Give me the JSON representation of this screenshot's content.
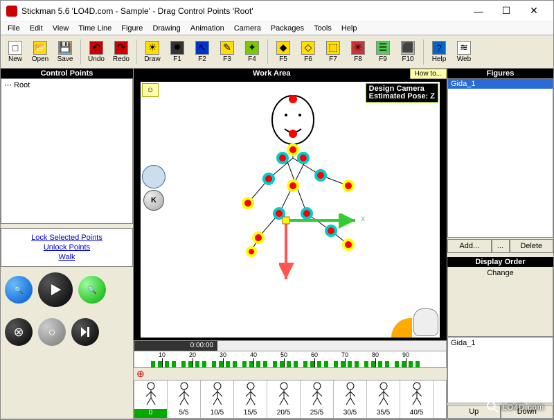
{
  "title": "Stickman 5.6  'LO4D.com - Sample' - Drag Control Points 'Root'",
  "menu": [
    "File",
    "Edit",
    "View",
    "Time Line",
    "Figure",
    "Drawing",
    "Animation",
    "Camera",
    "Packages",
    "Tools",
    "Help"
  ],
  "toolbar": [
    {
      "label": "New",
      "icon": "□",
      "hue": "#fff"
    },
    {
      "label": "Open",
      "icon": "📂",
      "hue": "#fd0"
    },
    {
      "label": "Save",
      "icon": "💾",
      "hue": "#b96"
    },
    {
      "sep": true
    },
    {
      "label": "Undo",
      "icon": "↶",
      "hue": "#c00"
    },
    {
      "label": "Redo",
      "icon": "↷",
      "hue": "#c00"
    },
    {
      "sep": true
    },
    {
      "label": "Draw",
      "icon": "☀",
      "hue": "#fd0"
    },
    {
      "label": "F1",
      "icon": "✸",
      "hue": "#333"
    },
    {
      "label": "F2",
      "icon": "↖",
      "hue": "#03c"
    },
    {
      "label": "F3",
      "icon": "✎",
      "hue": "#fd0"
    },
    {
      "label": "F4",
      "icon": "✦",
      "hue": "#7c0"
    },
    {
      "sep": true
    },
    {
      "label": "F5",
      "icon": "◆",
      "hue": "#fd0"
    },
    {
      "label": "F6",
      "icon": "◇",
      "hue": "#fd0"
    },
    {
      "label": "F7",
      "icon": "⬚",
      "hue": "#fd0"
    },
    {
      "label": "F8",
      "icon": "✳",
      "hue": "#c33"
    },
    {
      "label": "F9",
      "icon": "☰",
      "hue": "#5c5"
    },
    {
      "label": "F10",
      "icon": "⬛",
      "hue": "#bbb"
    },
    {
      "sep": true
    },
    {
      "label": "Help",
      "icon": "?",
      "hue": "#06c"
    },
    {
      "label": "Web",
      "icon": "≋",
      "hue": "#fff"
    }
  ],
  "left": {
    "title": "Control Points",
    "tree_item": "Root",
    "links": [
      "Lock Selected Points",
      "Unlock Points",
      "Walk"
    ]
  },
  "center": {
    "title": "Work Area",
    "howto": "How to...",
    "badge1": "Design Camera",
    "badge2": "Estimated Pose: Z",
    "k": "K",
    "x": "x",
    "time": "0:00:00",
    "ruler": [
      10,
      20,
      30,
      40,
      50,
      60,
      70,
      80,
      90
    ],
    "frames": [
      "0",
      "5/5",
      "10/5",
      "15/5",
      "20/5",
      "25/5",
      "30/5",
      "35/5",
      "40/5"
    ]
  },
  "right": {
    "fig_title": "Figures",
    "fig_item": "Gida_1",
    "add": "Add...",
    "dots": "...",
    "del": "Delete",
    "disp_title": "Display Order",
    "change": "Change",
    "disp_item": "Gida_1",
    "up": "Up",
    "down": "Down"
  },
  "watermark": "LO4D.com"
}
